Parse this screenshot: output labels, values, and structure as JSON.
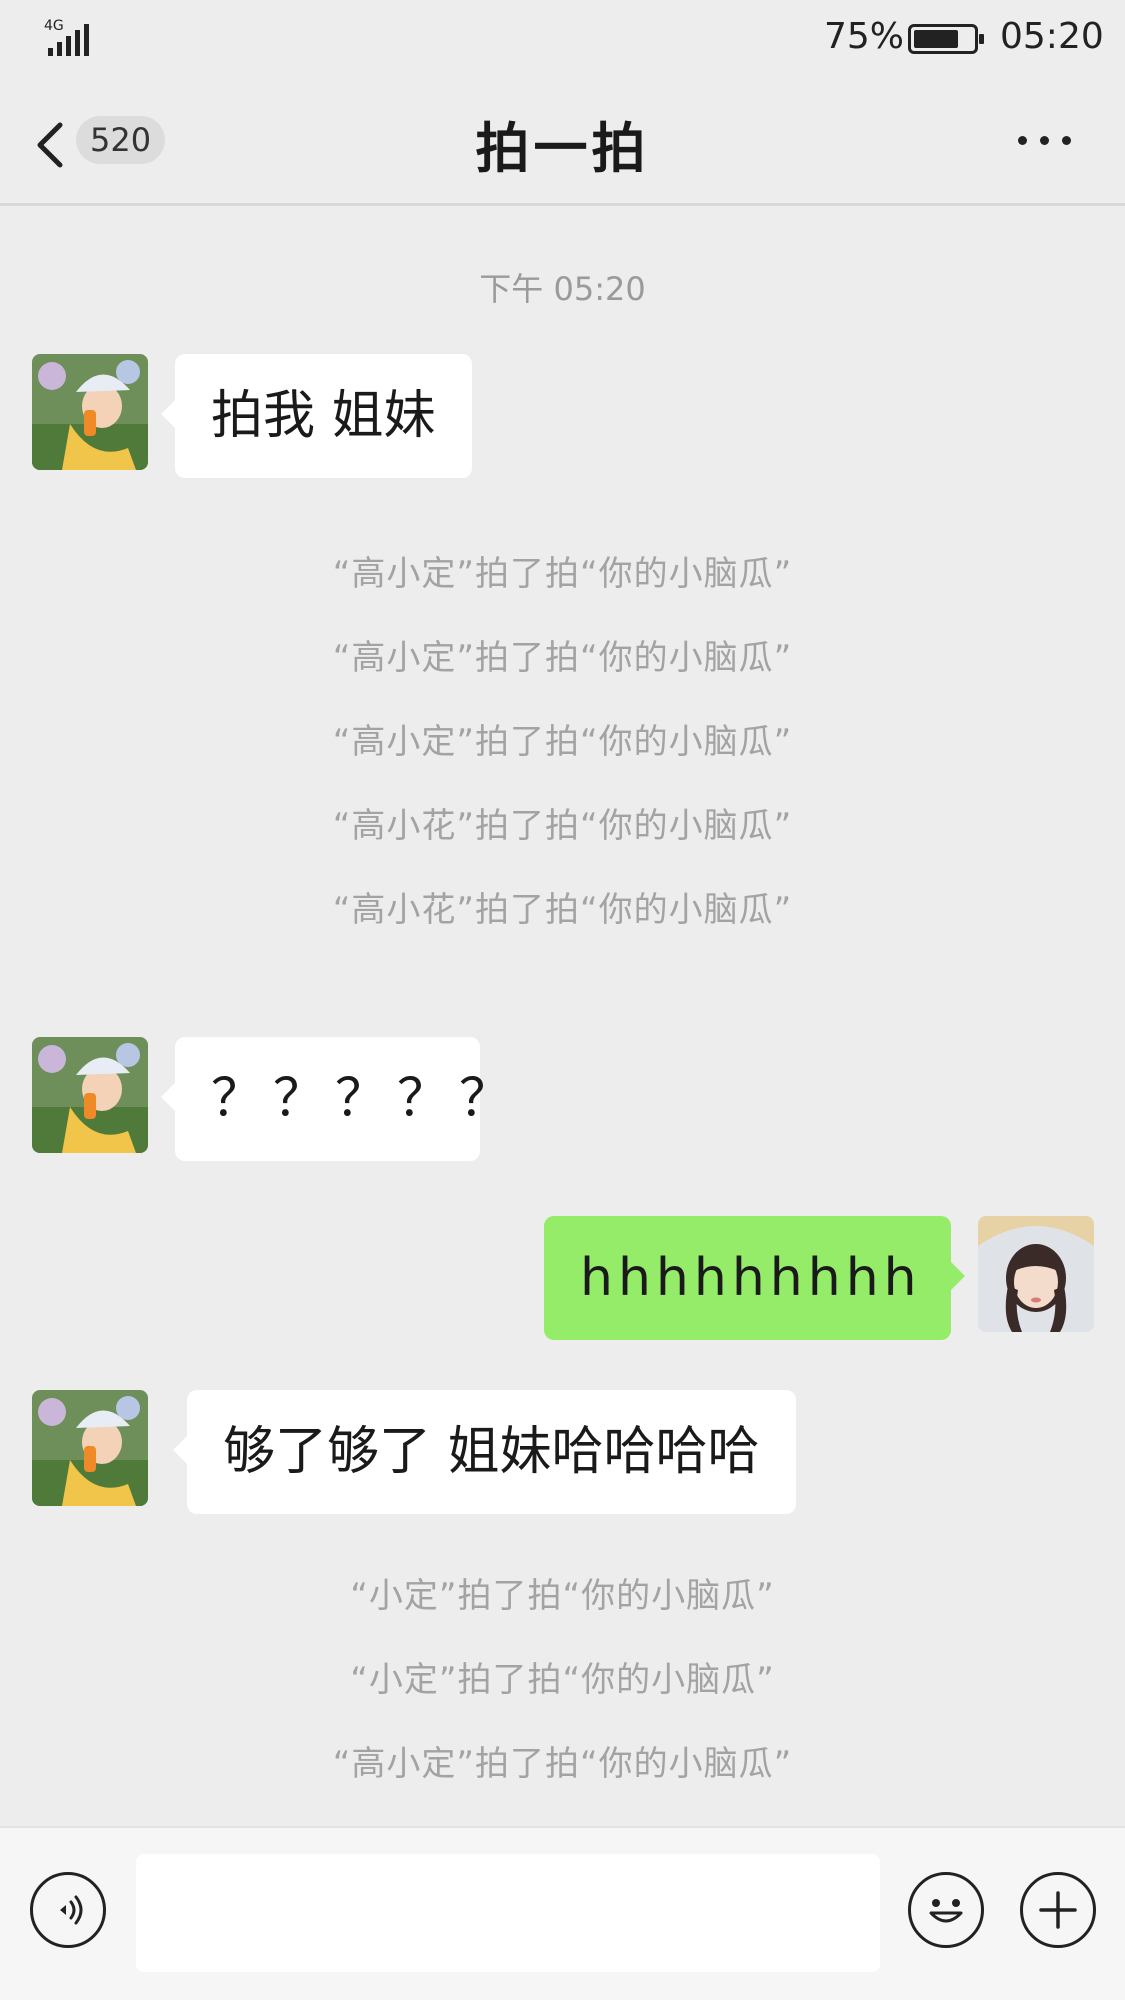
{
  "status_bar": {
    "network": "4G",
    "battery_percent": "75%",
    "battery_level": 0.75,
    "time": "05:20"
  },
  "nav": {
    "unread_count": "520",
    "title": "拍一拍",
    "back_icon": "chevron-left-icon",
    "more_icon": "more-dots-icon"
  },
  "chat": {
    "timestamp": "下午 05:20",
    "messages": [
      {
        "side": "left",
        "text": "拍我 姐妹"
      },
      {
        "side": "left",
        "text": "？？？？？"
      },
      {
        "side": "right",
        "text": "hhhhhhhhh"
      },
      {
        "side": "left",
        "text": "够了够了 姐妹哈哈哈哈"
      }
    ],
    "system_group_1": [
      "“高小定”拍了拍“你的小脑瓜”",
      "“高小定”拍了拍“你的小脑瓜”",
      "“高小定”拍了拍“你的小脑瓜”",
      "“高小花”拍了拍“你的小脑瓜”",
      "“高小花”拍了拍“你的小脑瓜”"
    ],
    "system_group_2": [
      "“小定”拍了拍“你的小脑瓜”",
      "“小定”拍了拍“你的小脑瓜”",
      "“高小定”拍了拍“你的小脑瓜”"
    ]
  },
  "input_bar": {
    "voice_icon": "voice-icon",
    "emoji_icon": "emoji-icon",
    "plus_icon": "plus-icon",
    "text_value": ""
  },
  "colors": {
    "background": "#ededed",
    "bubble_self": "#95ec69",
    "bubble_other": "#ffffff",
    "system_text": "#a3a3a3"
  }
}
